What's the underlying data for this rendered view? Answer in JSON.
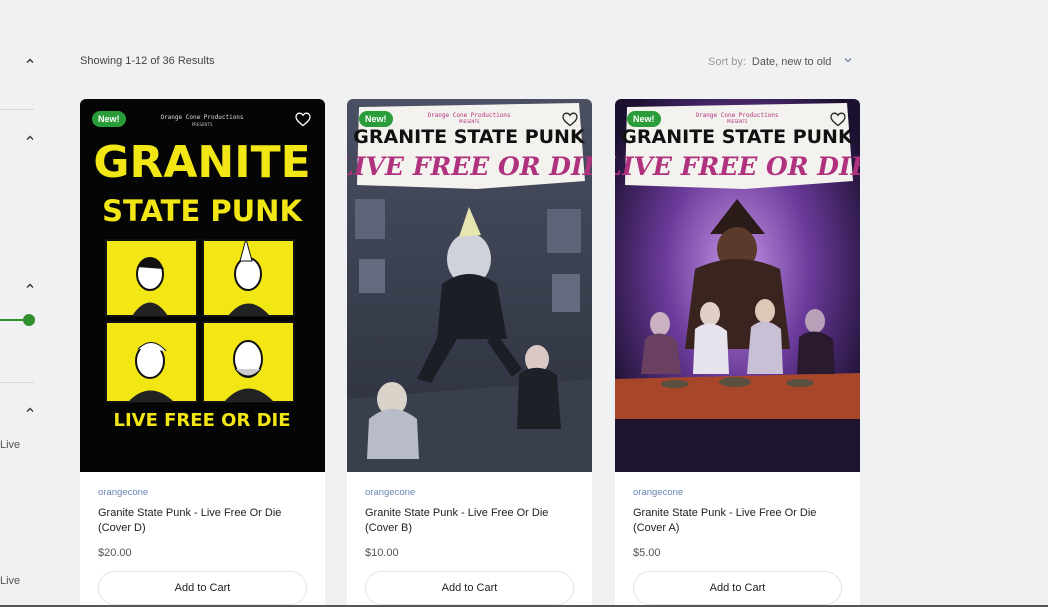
{
  "sidebar": {
    "texts": [
      "Live",
      "Live"
    ]
  },
  "toolbar": {
    "results_label": "Showing 1-12 of 36 Results",
    "sort_label": "Sort by:",
    "sort_value": "Date, new to old"
  },
  "products": [
    {
      "badge": "New!",
      "vendor": "orangecone",
      "title": "Granite State Punk - Live Free Or Die (Cover D)",
      "price": "$20.00",
      "button": "Add to Cart",
      "cover": {
        "publisher": "Orange Cone Productions",
        "presents": "PRESENTS",
        "line1": "GRANITE",
        "line2": "STATE PUNK",
        "subtitle": "LIVE FREE OR DIE"
      }
    },
    {
      "badge": "New!",
      "vendor": "orangecone",
      "title": "Granite State Punk - Live Free Or Die (Cover B)",
      "price": "$10.00",
      "button": "Add to Cart",
      "cover": {
        "publisher": "Orange Cone Productions",
        "presents": "PRESENTS",
        "line1": "GRANITE STATE PUNK",
        "subtitle": "LIVE FREE OR DIE"
      }
    },
    {
      "badge": "New!",
      "vendor": "orangecone",
      "title": "Granite State Punk - Live Free Or Die (Cover A)",
      "price": "$5.00",
      "button": "Add to Cart",
      "cover": {
        "publisher": "Orange Cone Productions",
        "presents": "PRESENTS",
        "line1": "GRANITE STATE PUNK",
        "subtitle": "LIVE FREE OR DIE"
      }
    }
  ],
  "colors": {
    "badge_green": "#2a9d3a",
    "vendor_blue": "#6b84b0",
    "slider_green": "#2f8f2f",
    "cover_yellow": "#f2e614",
    "cover_magenta": "#b0327f"
  }
}
